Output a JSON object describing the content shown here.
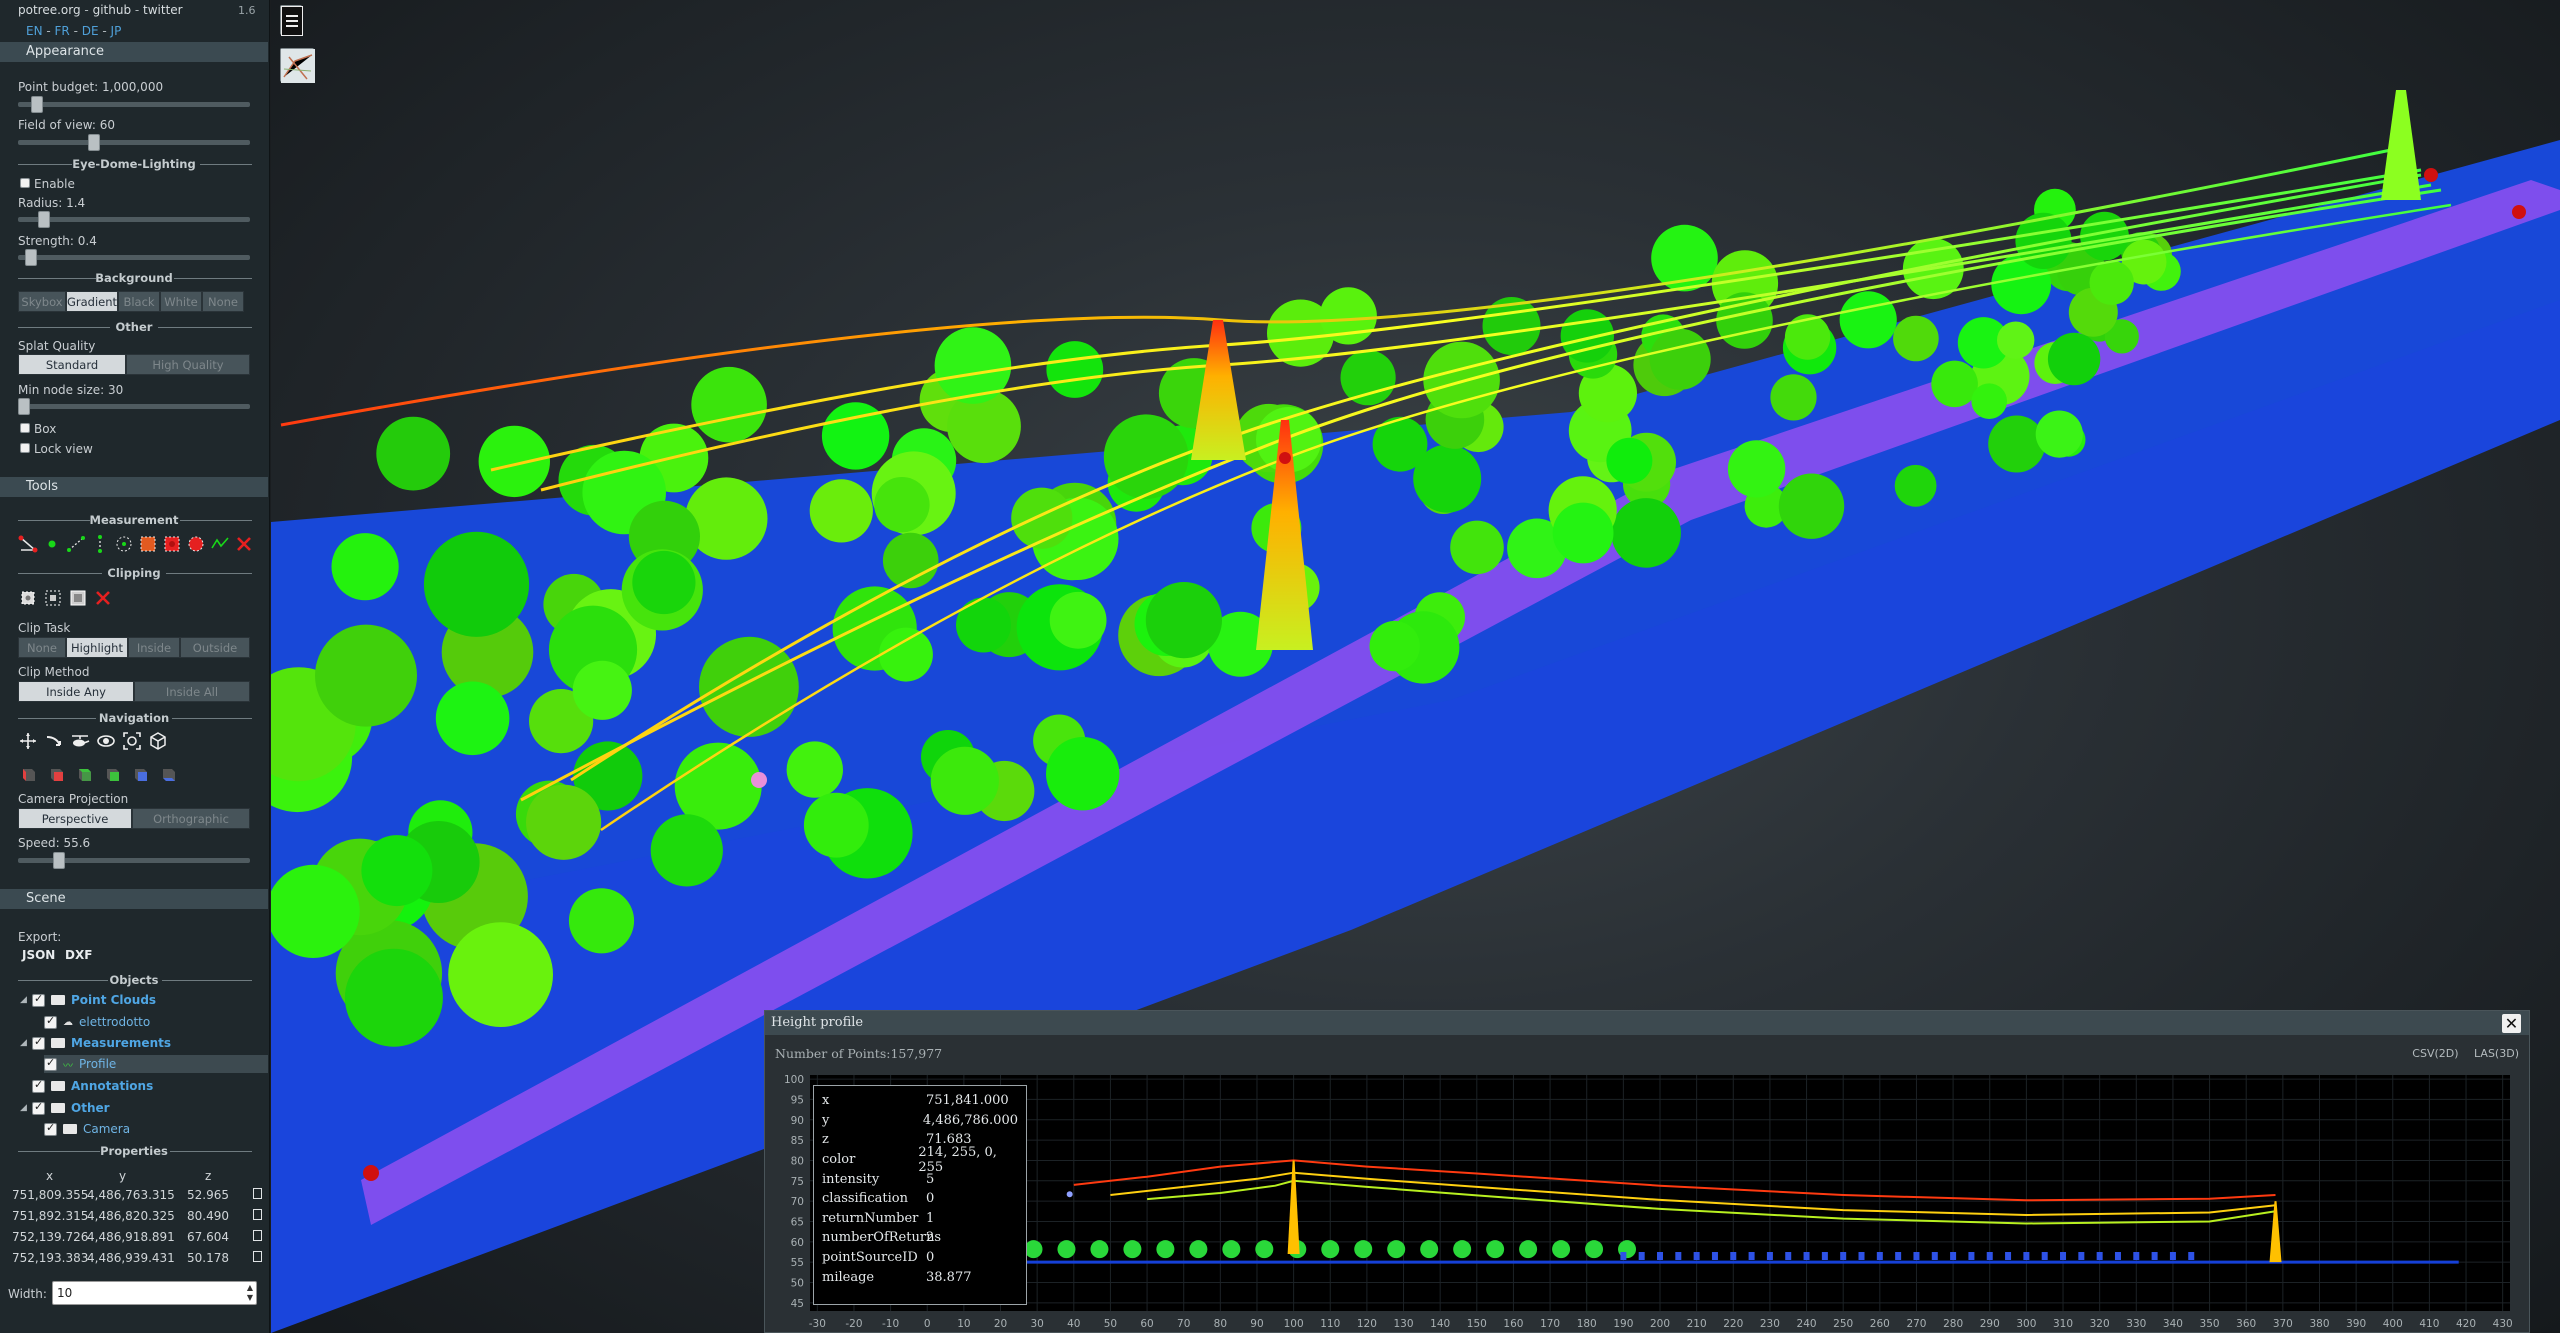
{
  "header": {
    "links": [
      "potree.org",
      "github",
      "twitter"
    ],
    "separator": " - ",
    "version": "1.6",
    "languages": [
      "EN",
      "FR",
      "DE",
      "JP"
    ]
  },
  "appearance": {
    "title": "Appearance",
    "point_budget_label": "Point budget: 1,000,000",
    "point_budget_value": 0.06,
    "fov_label": "Field of view: 60",
    "fov_value": 0.32,
    "edl_title": "Eye-Dome-Lighting",
    "edl_enable_label": "Enable",
    "edl_radius_label": "Radius: 1.4",
    "edl_radius_value": 0.09,
    "edl_strength_label": "Strength: 0.4",
    "edl_strength_value": 0.03,
    "background_title": "Background",
    "background_options": [
      "Skybox",
      "Gradient",
      "Black",
      "White",
      "None"
    ],
    "background_selected": "Gradient",
    "other_title": "Other",
    "splat_quality_label": "Splat Quality",
    "splat_options": [
      "Standard",
      "High Quality"
    ],
    "splat_selected": "Standard",
    "min_node_label": "Min node size: 30",
    "min_node_value": 0.0,
    "box_label": "Box",
    "lock_view_label": "Lock view"
  },
  "tools": {
    "title": "Tools",
    "measurement_title": "Measurement",
    "measurement_icons": [
      "angle-icon",
      "point-icon",
      "distance-icon",
      "height-icon",
      "circle-icon",
      "area-icon",
      "volume-icon",
      "sphere-volume-icon",
      "profile-icon",
      "remove-icon"
    ],
    "clipping_title": "Clipping",
    "clipping_icons": [
      "clip-volume-icon",
      "clip-polygon-icon",
      "clip-screen-box-icon",
      "remove-clip-icon"
    ],
    "clip_task_label": "Clip Task",
    "clip_task_options": [
      "None",
      "Highlight",
      "Inside",
      "Outside"
    ],
    "clip_task_selected": "Highlight",
    "clip_method_label": "Clip Method",
    "clip_method_options": [
      "Inside Any",
      "Inside All"
    ],
    "clip_method_selected": "Inside Any",
    "navigation_title": "Navigation",
    "navigation_icons": [
      "earth-controls-icon",
      "fly-controls-icon",
      "helicopter-controls-icon",
      "orbit-controls-icon",
      "focus-icon",
      "navigation-cube-icon"
    ],
    "view_icons": [
      "left-view-icon",
      "front-view-icon",
      "top-view-icon",
      "back-view-icon",
      "right-view-icon",
      "bottom-view-icon"
    ],
    "camera_projection_label": "Camera Projection",
    "camera_projection_options": [
      "Perspective",
      "Orthographic"
    ],
    "camera_projection_selected": "Perspective",
    "speed_label": "Speed: 55.6",
    "speed_value": 0.16
  },
  "scene": {
    "title": "Scene",
    "export_label": "Export:",
    "export_options": [
      "JSON",
      "DXF"
    ],
    "objects_title": "Objects",
    "tree": [
      {
        "label": "Point Clouds",
        "level": 0,
        "bold": true
      },
      {
        "label": "elettrodotto",
        "level": 1,
        "bold": false
      },
      {
        "label": "Measurements",
        "level": 0,
        "bold": true
      },
      {
        "label": "Profile",
        "level": 1,
        "bold": false
      },
      {
        "label": "Annotations",
        "level": 0,
        "bold": true
      },
      {
        "label": "Other",
        "level": 0,
        "bold": true
      },
      {
        "label": "Camera",
        "level": 1,
        "bold": false
      }
    ],
    "properties_title": "Properties",
    "properties_headers": [
      "x",
      "y",
      "z"
    ],
    "properties_rows": [
      [
        "751,809.355",
        "4,486,763.315",
        "52.965"
      ],
      [
        "751,892.315",
        "4,486,820.325",
        "80.490"
      ],
      [
        "752,139.726",
        "4,486,918.891",
        "67.604"
      ],
      [
        "752,193.383",
        "4,486,939.431",
        "50.178"
      ]
    ],
    "width_label": "Width:",
    "width_value": "10"
  },
  "viewport": {
    "menu_icon": "hamburger-icon",
    "map_icon": "map-icon"
  },
  "profile": {
    "title": "Height profile",
    "points_label": "Number of Points:157,977",
    "export_options": [
      "CSV(2D)",
      "LAS(3D)"
    ],
    "info": [
      [
        "x",
        "751,841.000"
      ],
      [
        "y",
        "4,486,786.000"
      ],
      [
        "z",
        "71.683"
      ],
      [
        "color",
        "214, 255, 0, 255"
      ],
      [
        "intensity",
        "5"
      ],
      [
        "classification",
        "0"
      ],
      [
        "returnNumber",
        "1"
      ],
      [
        "numberOfReturns",
        "2"
      ],
      [
        "pointSourceID",
        "0"
      ],
      [
        "mileage",
        "38.877"
      ]
    ]
  },
  "chart_data": {
    "type": "scatter",
    "title": "",
    "xlabel": "",
    "ylabel": "",
    "x_ticks": [
      -30,
      -20,
      -10,
      0,
      10,
      20,
      30,
      40,
      50,
      60,
      70,
      80,
      90,
      100,
      110,
      120,
      130,
      140,
      150,
      160,
      170,
      180,
      190,
      200,
      210,
      220,
      230,
      240,
      250,
      260,
      270,
      280,
      290,
      300,
      310,
      320,
      330,
      340,
      350,
      360,
      370,
      380,
      390,
      400,
      410,
      420,
      430
    ],
    "y_ticks": [
      45,
      50,
      55,
      60,
      65,
      70,
      75,
      80,
      85,
      90,
      95,
      100
    ],
    "xlim": [
      -32,
      432
    ],
    "ylim": [
      43,
      101
    ],
    "series": [
      {
        "x": [
          40,
          60,
          80,
          100,
          120,
          150,
          200,
          250,
          300,
          350,
          368
        ],
        "values": [
          74,
          76,
          78.5,
          80,
          78.5,
          76.8,
          73.8,
          71.5,
          70.2,
          70.6,
          71.5
        ]
      },
      {
        "x": [
          50,
          70,
          90,
          100,
          120,
          150,
          200,
          250,
          300,
          350,
          368
        ],
        "values": [
          71.5,
          73.5,
          75.5,
          77,
          75.5,
          73.5,
          70.3,
          67.8,
          66.6,
          67.2,
          69
        ]
      },
      {
        "x": [
          60,
          80,
          95,
          100,
          120,
          150,
          200,
          250,
          300,
          350,
          368
        ],
        "values": [
          70.5,
          72,
          73.8,
          75,
          73.5,
          71.4,
          68.1,
          65.7,
          64.5,
          65,
          67.5
        ]
      }
    ],
    "towers": [
      {
        "x": 100,
        "base": 57,
        "top": 80
      },
      {
        "x": 368,
        "base": 55,
        "top": 70
      }
    ],
    "ground": 55,
    "selected_point": {
      "x": 38.877,
      "y": 71.683
    }
  }
}
